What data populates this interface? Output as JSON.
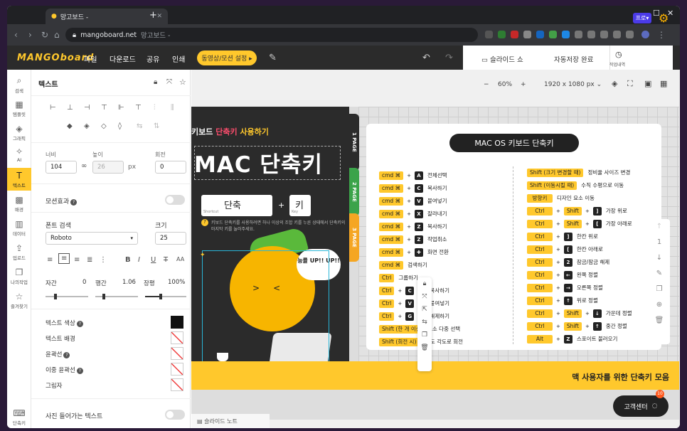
{
  "browser": {
    "tab_title": "망고보드 -",
    "url_host": "mangoboard.net",
    "url_rest": "망고보드 -"
  },
  "header": {
    "logo": "MANGOboard",
    "menus": [
      "파일",
      "다운로드",
      "공유",
      "인쇄"
    ],
    "action_button": "동영상/모션 설정 ▸",
    "slideshow": "슬라이드 쇼",
    "autosave": "자동저장 완료",
    "history_label": "작업내역",
    "plan_badge": "프로▾"
  },
  "rail": [
    {
      "label": "검색",
      "icon": "search-icon"
    },
    {
      "label": "템플릿",
      "icon": "template-icon"
    },
    {
      "label": "그래픽",
      "icon": "graphic-icon"
    },
    {
      "label": "AI",
      "icon": "ai-icon"
    },
    {
      "label": "텍스트",
      "icon": "text-icon"
    },
    {
      "label": "배경",
      "icon": "background-icon"
    },
    {
      "label": "데이터",
      "icon": "chart-icon"
    },
    {
      "label": "업로드",
      "icon": "upload-icon"
    },
    {
      "label": "나의작업",
      "icon": "folder-icon"
    },
    {
      "label": "즐겨찾기",
      "icon": "star-icon"
    },
    {
      "label": "단축키",
      "icon": "keyboard-icon"
    }
  ],
  "panel": {
    "title": "텍스트",
    "width_label": "너비",
    "width": "104",
    "height_label": "높이",
    "height": "26",
    "unit": "px",
    "rotate_label": "회전",
    "rotate": "0",
    "motion_label": "모션효과",
    "font_search_label": "폰트 검색",
    "font": "Roboto",
    "size_label": "크기",
    "size": "25",
    "letter_label": "자간",
    "letter": "0",
    "line_label": "행간",
    "line": "1.06",
    "long_label": "장평",
    "long": "100%",
    "color_label": "텍스트 색상",
    "bg_label": "텍스트 배경",
    "outline_label": "윤곽선",
    "double_outline_label": "이중 윤곽선",
    "shadow_label": "그림자",
    "sticker_label": "사진 들어가는 텍스트"
  },
  "canvas": {
    "zoom": "60%",
    "minus": "−",
    "plus": "+",
    "resolution": "1920 x 1080 px ⌄",
    "slide_note": "슬라이드 노트"
  },
  "slide": {
    "kb_title_a": "키보드",
    "kb_title_b": "단축키",
    "kb_title_c": "사용하기",
    "mac_title": "MAC 단축키",
    "shortcut": "단축",
    "shortcut_sub": "Shortcut",
    "key": "키",
    "key_sub": "Key",
    "desc": "키보드 단축키를 사용하려면 하나 이상의 조합 키를 누른 상태에서 단축키의 마지막 키를 눌러주세요.",
    "bubble": "능률 UP!! UP!!",
    "page_tabs": [
      "1 PAGE",
      "2 PAGE",
      "3 PAGE"
    ],
    "band_text": "맥 사용자를 위한 단축키 모음",
    "card_title": "MAC OS 키보드 단축키"
  },
  "left_shortcuts": [
    {
      "mod": "cmd ⌘",
      "key": "A",
      "desc": "전체선택"
    },
    {
      "mod": "cmd ⌘",
      "key": "C",
      "desc": "복사하기"
    },
    {
      "mod": "cmd ⌘",
      "key": "V",
      "desc": "붙여넣기"
    },
    {
      "mod": "cmd ⌘",
      "key": "X",
      "desc": "잘라내기"
    },
    {
      "mod": "cmd ⌘",
      "key": "Z",
      "desc": "복사하기"
    },
    {
      "mod": "cmd ⌘",
      "key": "Z",
      "desc": "작업취소"
    },
    {
      "mod": "cmd ⌘",
      "key": "✚",
      "desc": "화면 전환"
    },
    {
      "mod": "cmd ⌘",
      "key": "",
      "desc": "검색하기"
    },
    {
      "mod": "Ctrl",
      "key": "",
      "desc": "그룹하기"
    },
    {
      "mod": "Ctrl",
      "key": "C",
      "desc": "서식 복사하기"
    },
    {
      "mod": "Ctrl",
      "key": "V",
      "desc": "서식 붙여넣기"
    },
    {
      "mod": "Ctrl",
      "key": "G",
      "desc": "그룹 해제하기"
    },
    {
      "mod": "Shift (한 개 이상 선택할 경우)",
      "key": "",
      "desc": "요소 다중 선택"
    },
    {
      "mod": "Shift (회전 시)",
      "key": "",
      "desc": "45도 각도로 회전"
    }
  ],
  "right_shortcuts": [
    {
      "mod": "Shift (크기 변경할 때)",
      "mid": "",
      "key": "",
      "desc": "정비율 사이즈 변경"
    },
    {
      "mod": "Shift (이동시킬 때)",
      "mid": "",
      "key": "",
      "desc": "수직 수평으로 이동"
    },
    {
      "mod": "방향키",
      "mid": "",
      "key": "",
      "desc": "디자인 요소 이동"
    },
    {
      "mod": "Ctrl",
      "mid": "Shift",
      "key": "]",
      "desc": "가장 위로"
    },
    {
      "mod": "Ctrl",
      "mid": "Shift",
      "key": "[",
      "desc": "가장 아래로"
    },
    {
      "mod": "Ctrl",
      "mid": "",
      "key": "]",
      "desc": "한칸 위로"
    },
    {
      "mod": "Ctrl",
      "mid": "",
      "key": "[",
      "desc": "한칸 아래로"
    },
    {
      "mod": "Ctrl",
      "mid": "",
      "key": "2",
      "desc": "잠금/잠금 해제"
    },
    {
      "mod": "Ctrl",
      "mid": "",
      "key": "←",
      "desc": "왼쪽 정렬"
    },
    {
      "mod": "Ctrl",
      "mid": "",
      "key": "→",
      "desc": "오른쪽 정렬"
    },
    {
      "mod": "Ctrl",
      "mid": "",
      "key": "↑",
      "desc": "위로 정렬"
    },
    {
      "mod": "Ctrl",
      "mid": "Shift",
      "key": "↓",
      "desc": "가운데 정렬"
    },
    {
      "mod": "Ctrl",
      "mid": "Shift",
      "key": "↑",
      "desc": "중간 정렬"
    },
    {
      "mod": "Alt",
      "mid": "",
      "key": "Z",
      "desc": "스포이트 불러오기"
    }
  ],
  "help": {
    "label": "고객센터",
    "badge": "10"
  },
  "page_nav": {
    "current": "1"
  }
}
